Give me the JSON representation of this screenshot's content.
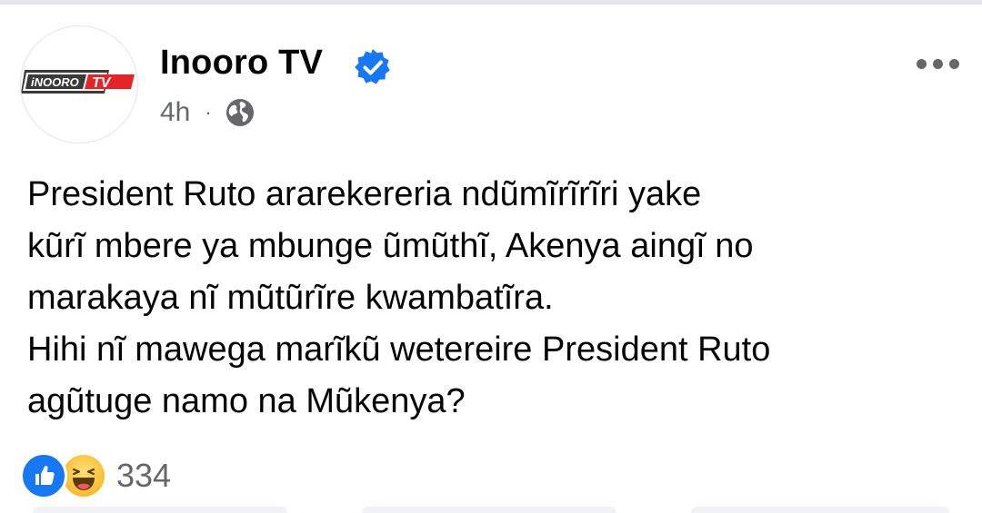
{
  "post": {
    "author": {
      "name": "Inooro TV",
      "logo_text_left": "iNOORO",
      "logo_text_right": "TV",
      "verified": true
    },
    "timestamp": "4h",
    "meta_separator": "·",
    "audience_icon": "globe-icon",
    "more_icon": "more-options-icon",
    "text_lines": [
      "President Ruto ararekereria ndũmĩrĩrĩri yake",
      "kũrĩ mbere ya mbunge ũmũthĩ, Akenya aingĩ no",
      "marakaya nĩ mũtũrĩre kwambatĩra.",
      "Hihi nĩ mawega marĩkũ wetereire President Ruto",
      "agũtuge namo na Mũkenya?"
    ],
    "reactions": {
      "types": [
        "like-reaction-icon",
        "haha-reaction-icon"
      ],
      "count": "334"
    }
  },
  "colors": {
    "primary_text": "#050505",
    "secondary_text": "#65676b",
    "verified_blue": "#1877f2",
    "like_blue": "#1877f2",
    "haha_yellow": "#f7b928",
    "logo_red": "#e5242a",
    "logo_dark": "#3a3a3a"
  }
}
